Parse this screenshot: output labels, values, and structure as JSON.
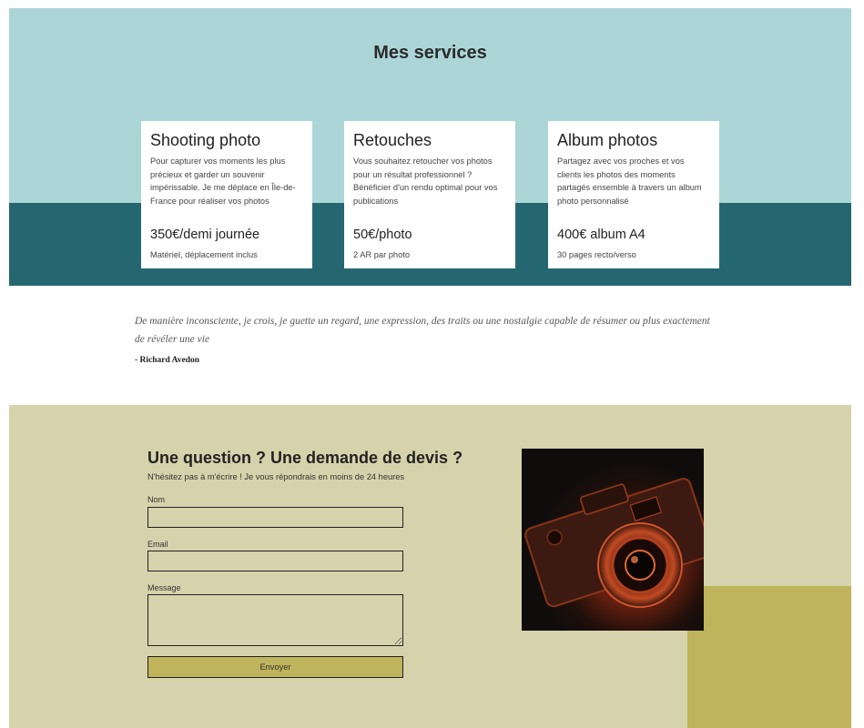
{
  "services": {
    "title": "Mes services",
    "cards": [
      {
        "title": "Shooting photo",
        "description": "Pour capturer vos moments les plus précieux et garder un souvenir impérissable. Je me déplace en Île-de-France pour réaliser vos photos",
        "price": "350€/demi journée",
        "note": "Matériel, déplacement inclus"
      },
      {
        "title": "Retouches",
        "description": "Vous souhaitez retoucher vos photos pour un résultat professionnel ? Bénéficier d'un rendu optimal pour vos publications",
        "price": "50€/photo",
        "note": "2 AR par photo"
      },
      {
        "title": "Album photos",
        "description": "Partagez avec vos proches et vos clients les photos des moments partagés ensemble à travers un album photo personnalisé",
        "price": "400€ album A4",
        "note": "30 pages recto/verso"
      }
    ]
  },
  "quote": {
    "text": "De manière inconsciente, je crois, je guette un regard, une expression, des traits ou une nostalgie capable de résumer ou plus exactement de révéler une vie",
    "author": "- Richard Avedon"
  },
  "contact": {
    "title": "Une question ? Une demande de devis ?",
    "subtitle": "N'hésitez pas à m'écrire ! Je vous répondrais en moins de 24 heures",
    "name_label": "Nom",
    "email_label": "Email",
    "message_label": "Message",
    "name_value": "",
    "email_value": "",
    "message_value": "",
    "submit_label": "Envoyer",
    "photo_icon": "camera-photo"
  },
  "colors": {
    "services_light": "#acd5d7",
    "services_dark": "#256770",
    "contact_bg": "#d6d2ab",
    "accent_olive": "#bfb35c"
  }
}
